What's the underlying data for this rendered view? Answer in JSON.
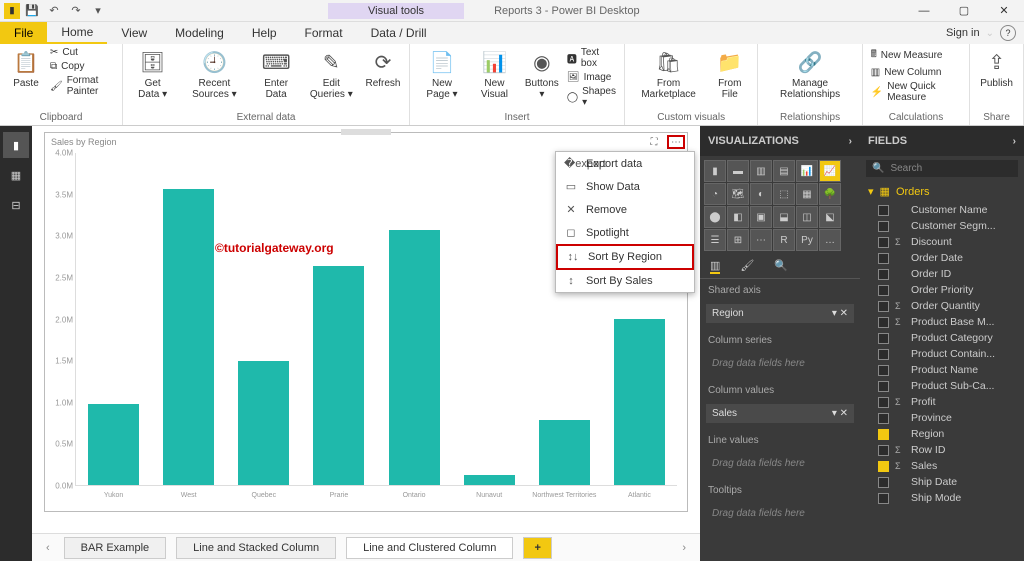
{
  "titlebar": {
    "visual_tools": "Visual tools",
    "title": "Reports 3 - Power BI Desktop"
  },
  "menubar": {
    "file": "File",
    "items": [
      "Home",
      "View",
      "Modeling",
      "Help",
      "Format",
      "Data / Drill"
    ],
    "signin": "Sign in"
  },
  "ribbon": {
    "clipboard": {
      "paste": "Paste",
      "cut": "Cut",
      "copy": "Copy",
      "format_painter": "Format Painter",
      "label": "Clipboard"
    },
    "external": {
      "get_data": "Get\nData ▾",
      "recent": "Recent\nSources ▾",
      "enter": "Enter\nData",
      "edit_q": "Edit\nQueries ▾",
      "refresh": "Refresh",
      "label": "External data"
    },
    "insert": {
      "new_page": "New\nPage ▾",
      "new_visual": "New\nVisual",
      "buttons": "Buttons\n▾",
      "text_box": "Text box",
      "image": "Image",
      "shapes": "Shapes ▾",
      "label": "Insert"
    },
    "custom": {
      "marketplace": "From\nMarketplace",
      "file": "From\nFile",
      "label": "Custom visuals"
    },
    "relationships": {
      "manage": "Manage\nRelationships",
      "label": "Relationships"
    },
    "calc": {
      "new_measure": "New Measure",
      "new_column": "New Column",
      "quick": "New Quick Measure",
      "label": "Calculations"
    },
    "share": {
      "publish": "Publish",
      "label": "Share"
    }
  },
  "visual": {
    "title": "Sales by Region",
    "watermark": "©tutorialgateway.org"
  },
  "chart_data": {
    "type": "bar",
    "title": "Sales by Region",
    "xlabel": "",
    "ylabel": "",
    "ylim": [
      0,
      4000000
    ],
    "yticks": [
      "0.0M",
      "0.5M",
      "1.0M",
      "1.5M",
      "2.0M",
      "2.5M",
      "3.0M",
      "3.5M",
      "4.0M"
    ],
    "categories": [
      "Yukon",
      "West",
      "Quebec",
      "Prarie",
      "Ontario",
      "Nunavut",
      "Northwest Territories",
      "Atlantic"
    ],
    "values": [
      980000,
      3570000,
      1500000,
      2640000,
      3070000,
      120000,
      780000,
      2000000
    ]
  },
  "context_menu": {
    "items": [
      {
        "icon": "�export",
        "label": "Export data"
      },
      {
        "icon": "▭",
        "label": "Show Data"
      },
      {
        "icon": "✕",
        "label": "Remove"
      },
      {
        "icon": "◻",
        "label": "Spotlight"
      },
      {
        "icon": "↕↓",
        "label": "Sort By Region",
        "highlighted": true
      },
      {
        "icon": "↕",
        "label": "Sort By Sales"
      }
    ]
  },
  "tabs": {
    "pages": [
      "BAR Example",
      "Line and Stacked Column",
      "Line and Clustered Column"
    ],
    "active_index": 2,
    "add": "+"
  },
  "viz_panel": {
    "header": "VISUALIZATIONS",
    "sections": {
      "shared_axis": "Shared axis",
      "region": "Region",
      "column_series": "Column series",
      "drag1": "Drag data fields here",
      "column_values": "Column values",
      "sales": "Sales",
      "line_values": "Line values",
      "drag2": "Drag data fields here",
      "tooltips": "Tooltips",
      "drag3": "Drag data fields here"
    }
  },
  "fields_panel": {
    "header": "FIELDS",
    "search_placeholder": "Search",
    "table": "Orders",
    "fields": [
      {
        "name": "Customer Name",
        "checked": false
      },
      {
        "name": "Customer Segm...",
        "checked": false
      },
      {
        "name": "Discount",
        "checked": false,
        "sigma": true
      },
      {
        "name": "Order Date",
        "checked": false
      },
      {
        "name": "Order ID",
        "checked": false
      },
      {
        "name": "Order Priority",
        "checked": false
      },
      {
        "name": "Order Quantity",
        "checked": false,
        "sigma": true
      },
      {
        "name": "Product Base M...",
        "checked": false,
        "sigma": true
      },
      {
        "name": "Product Category",
        "checked": false
      },
      {
        "name": "Product Contain...",
        "checked": false
      },
      {
        "name": "Product Name",
        "checked": false
      },
      {
        "name": "Product Sub-Ca...",
        "checked": false
      },
      {
        "name": "Profit",
        "checked": false,
        "sigma": true
      },
      {
        "name": "Province",
        "checked": false
      },
      {
        "name": "Region",
        "checked": true
      },
      {
        "name": "Row ID",
        "checked": false,
        "sigma": true
      },
      {
        "name": "Sales",
        "checked": true,
        "sigma": true
      },
      {
        "name": "Ship Date",
        "checked": false
      },
      {
        "name": "Ship Mode",
        "checked": false
      }
    ]
  }
}
